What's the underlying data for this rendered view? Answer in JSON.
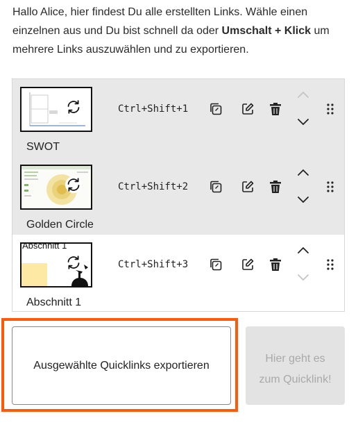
{
  "intro": {
    "text_1": "Hallo Alice, hier findest Du alle erstellten Links. Wähle einen einzelnen aus und Du bist schnell da oder ",
    "bold": "Umschalt + Klick",
    "text_2": " um mehrere Links auszuwählen und zu exportieren."
  },
  "quicklinks": [
    {
      "name": "SWOT",
      "shortcut": "Ctrl+Shift+1",
      "selected": true,
      "can_move_up": false,
      "can_move_down": true
    },
    {
      "name": "Golden Circle",
      "shortcut": "Ctrl+Shift+2",
      "selected": true,
      "can_move_up": true,
      "can_move_down": true
    },
    {
      "name": "Abschnitt 1",
      "shortcut": "Ctrl+Shift+3",
      "selected": false,
      "can_move_up": true,
      "can_move_down": false,
      "thumb_caption": "Abschnitt 1"
    }
  ],
  "buttons": {
    "export_label": "Ausgewählte Quicklinks exportieren",
    "go_label": "Hier geht es zum Quicklink!",
    "go_enabled": false
  },
  "icons": {
    "refresh": "refresh-icon",
    "copy": "copy-link-icon",
    "edit": "edit-icon",
    "delete": "trash-icon",
    "up": "chevron-up-icon",
    "down": "chevron-down-icon",
    "drag": "drag-handle-icon"
  },
  "colors": {
    "highlight_border": "#ff5a0a",
    "selected_row_bg": "#e8e8e8",
    "disabled_button_bg": "#e3e3e3"
  }
}
